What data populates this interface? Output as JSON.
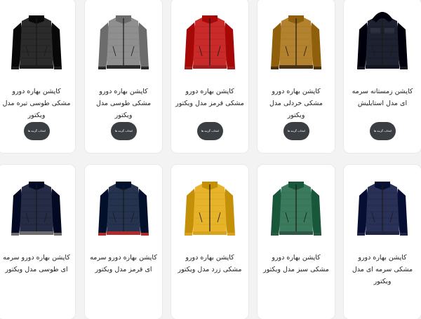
{
  "theme": {
    "button_bg": "#3b3f43"
  },
  "products": [
    {
      "title": "کاپشن بهاره دورو مشکی طوسی تیره مدل ویکتور",
      "button_label": "انتخاب گزینه ها",
      "jacket_color": "#2b2b2b",
      "trim_color": "#1c1c1c",
      "style": "bomber"
    },
    {
      "title": "کاپشن بهاره دورو مشکی طوسی مدل ویکتور",
      "button_label": "انتخاب گزینه ها",
      "jacket_color": "#8f8f8f",
      "trim_color": "#2a2a2a",
      "style": "bomber"
    },
    {
      "title": "کاپشن بهاره دورو مشکی قرمز مدل ویکتور",
      "button_label": "انتخاب گزینه ها",
      "jacket_color": "#c92a2a",
      "trim_color": "#a01f1f",
      "style": "bomber"
    },
    {
      "title": "کاپشن بهاره دورو مشکی خردلی مدل ویکتور",
      "button_label": "انتخاب گزینه ها",
      "jacket_color": "#b3822f",
      "trim_color": "#4a3215",
      "style": "bomber"
    },
    {
      "title": "کاپشن زمستانه سرمه ای مدل استایلیش",
      "button_label": "انتخاب گزینه ها",
      "jacket_color": "#1e2230",
      "trim_color": "#14161f",
      "style": "hooded"
    },
    {
      "title": "کاپشن بهاره دورو سرمه ای طوسی مدل ویکتور",
      "button_label": "",
      "jacket_color": "#262c45",
      "trim_color": "#6d6d6d",
      "style": "bomber"
    },
    {
      "title": "کاپشن بهاره دورو سرمه ای قرمز مدل ویکتور",
      "button_label": "",
      "jacket_color": "#25334f",
      "trim_color": "#b02a2a",
      "style": "bomber"
    },
    {
      "title": "کاپشن بهاره دورو مشکی زرد مدل ویکتور",
      "button_label": "",
      "jacket_color": "#e6b32a",
      "trim_color": "#d9a320",
      "style": "bomber"
    },
    {
      "title": "کاپشن بهاره دورو مشکی سبز مدل ویکتور",
      "button_label": "",
      "jacket_color": "#3c7a5e",
      "trim_color": "#2c5a46",
      "style": "bomber"
    },
    {
      "title": "کاپشن بهاره دورو مشکی سرمه ای مدل ویکتور",
      "button_label": "",
      "jacket_color": "#2a3156",
      "trim_color": "#1f2542",
      "style": "bomber"
    }
  ]
}
